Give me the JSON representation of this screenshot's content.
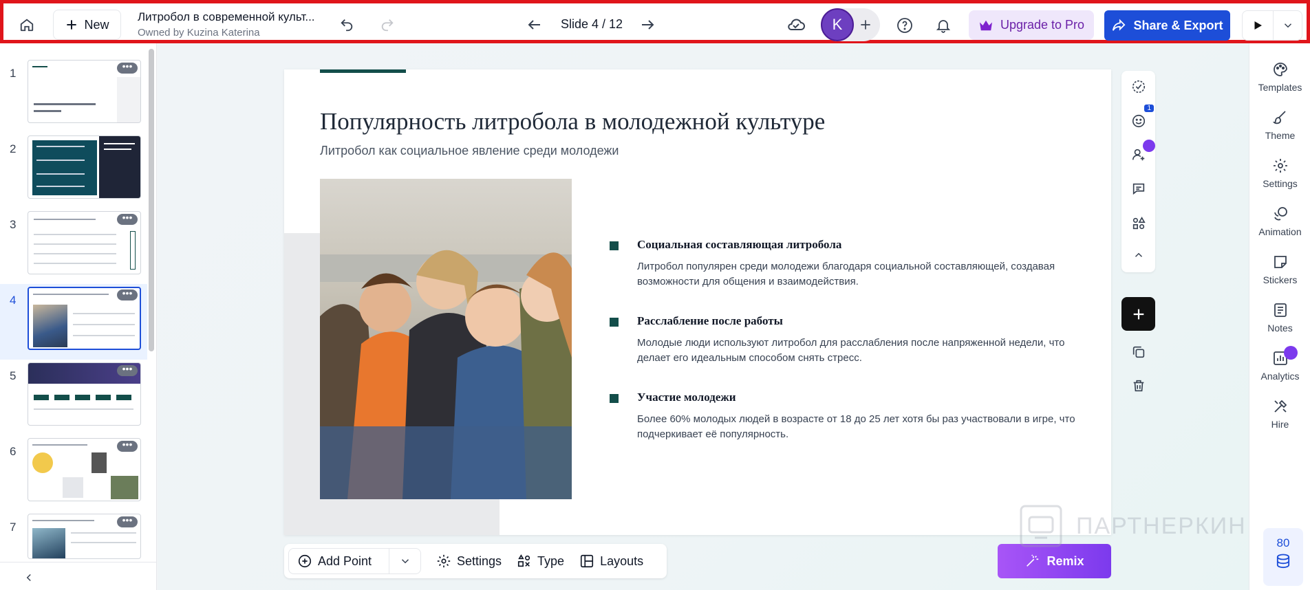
{
  "topbar": {
    "new_label": "New",
    "doc_title": "Литробол в современной культ...",
    "doc_owner": "Owned by Kuzina Katerina",
    "slide_indicator": "Slide 4 / 12",
    "avatar_initial": "K",
    "upgrade_label": "Upgrade to Pro",
    "share_label": "Share & Export"
  },
  "thumbnails": [
    {
      "num": "1"
    },
    {
      "num": "2"
    },
    {
      "num": "3"
    },
    {
      "num": "4"
    },
    {
      "num": "5"
    },
    {
      "num": "6"
    },
    {
      "num": "7"
    }
  ],
  "slide": {
    "title": "Популярность литробола в молодежной культуре",
    "subtitle": "Литробол как социальное явление среди молодежи",
    "points": [
      {
        "title": "Социальная составляющая литробола",
        "body": "Литробол популярен среди молодежи благодаря социальной составляющей, создавая возможности для общения и взаимодействия."
      },
      {
        "title": "Расслабление после работы",
        "body": "Молодые люди используют литробол для расслабления после напряженной недели, что делает его идеальным способом снять стресс."
      },
      {
        "title": "Участие молодежи",
        "body": "Более 60% молодых людей в возрасте от 18 до 25 лет хотя бы раз участвовали в игре, что подчеркивает её популярность."
      }
    ]
  },
  "vertical_toolbar": {
    "reactions_badge": "1"
  },
  "bottombar": {
    "add_point": "Add Point",
    "settings": "Settings",
    "type": "Type",
    "layouts": "Layouts"
  },
  "remix_label": "Remix",
  "watermark_text": "ПАРТНЕРКИН",
  "right_sidebar": {
    "items": [
      "Templates",
      "Theme",
      "Settings",
      "Animation",
      "Stickers",
      "Notes",
      "Analytics",
      "Hire"
    ]
  },
  "credits": "80",
  "colors": {
    "accent": "#134e4a",
    "primary": "#1d4ed8",
    "pro": "#7c3aed",
    "highlight_border": "#e0151b"
  }
}
